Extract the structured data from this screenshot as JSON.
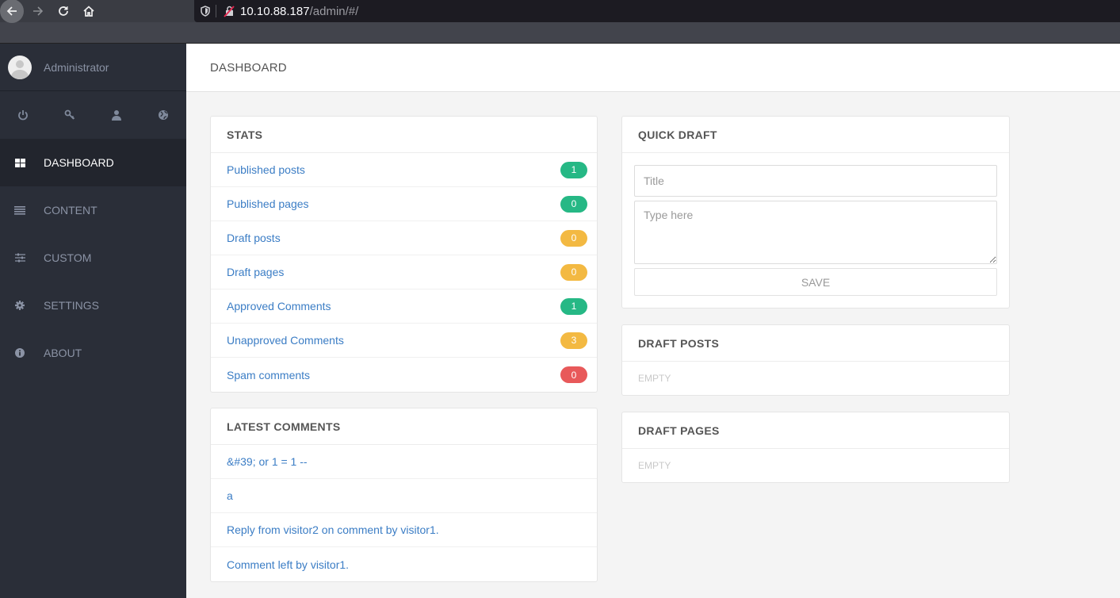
{
  "browser": {
    "url_host": "10.10.88.187",
    "url_path": "/admin/#/"
  },
  "sidebar": {
    "user_name": "Administrator",
    "quick_icons": [
      {
        "name": "power-icon",
        "glyph": "⏻"
      },
      {
        "name": "key-icon",
        "glyph": "⚷"
      },
      {
        "name": "user-icon",
        "glyph": "👤"
      },
      {
        "name": "globe-icon",
        "glyph": "🌐"
      }
    ],
    "items": [
      {
        "label": "DASHBOARD",
        "icon": "dashboard-icon",
        "active": true
      },
      {
        "label": "CONTENT",
        "icon": "list-icon",
        "active": false
      },
      {
        "label": "CUSTOM",
        "icon": "sliders-icon",
        "active": false
      },
      {
        "label": "SETTINGS",
        "icon": "gear-icon",
        "active": false
      },
      {
        "label": "ABOUT",
        "icon": "info-icon",
        "active": false
      }
    ]
  },
  "header": {
    "title": "DASHBOARD"
  },
  "colors": {
    "green": "#26b885",
    "yellow": "#f3b942",
    "red": "#e8595a",
    "link": "#3b7dc5"
  },
  "stats": {
    "title": "STATS",
    "rows": [
      {
        "label": "Published posts",
        "count": "1",
        "status": "green"
      },
      {
        "label": "Published pages",
        "count": "0",
        "status": "green"
      },
      {
        "label": "Draft posts",
        "count": "0",
        "status": "yellow"
      },
      {
        "label": "Draft pages",
        "count": "0",
        "status": "yellow"
      },
      {
        "label": "Approved Comments",
        "count": "1",
        "status": "green"
      },
      {
        "label": "Unapproved Comments",
        "count": "3",
        "status": "yellow"
      },
      {
        "label": "Spam comments",
        "count": "0",
        "status": "red"
      }
    ]
  },
  "latest_comments": {
    "title": "LATEST COMMENTS",
    "items": [
      "&#39; or 1 = 1 --",
      "a",
      "Reply from visitor2 on comment by visitor1.",
      "Comment left by visitor1."
    ]
  },
  "quick_draft": {
    "title": "QUICK DRAFT",
    "title_placeholder": "Title",
    "title_value": "",
    "body_placeholder": "Type here",
    "body_value": "",
    "save_label": "SAVE"
  },
  "draft_posts": {
    "title": "DRAFT POSTS",
    "empty_text": "EMPTY"
  },
  "draft_pages": {
    "title": "DRAFT PAGES",
    "empty_text": "EMPTY"
  }
}
